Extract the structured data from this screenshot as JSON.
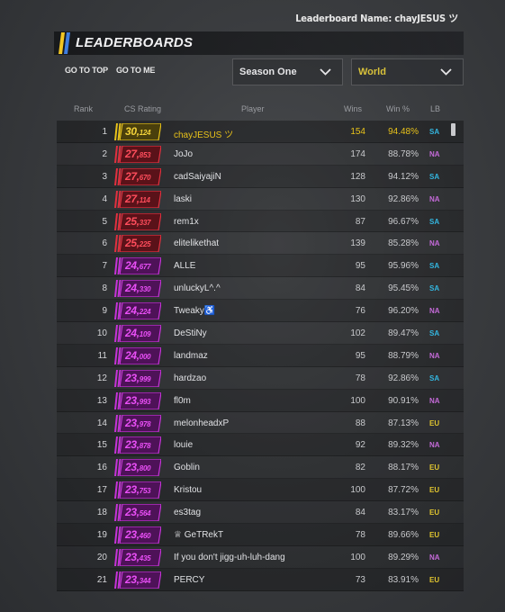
{
  "leaderboard_name": "Leaderboard Name: chayJESUS ツ",
  "title": "LEADERBOARDS",
  "nav": {
    "go_to_top": "GO TO TOP",
    "go_to_me": "GO TO ME"
  },
  "season_select": "Season One",
  "region_select": "World",
  "columns": {
    "rank": "Rank",
    "rating": "CS Rating",
    "player": "Player",
    "wins": "Wins",
    "win_pct": "Win %",
    "lb": "LB"
  },
  "colors": {
    "gold": "#e8c21a",
    "red": "#e2303f",
    "pink": "#c733d9",
    "sa": "#33b6e0",
    "na": "#c46ad8",
    "eu": "#e0c52f"
  },
  "rows": [
    {
      "rank": "1",
      "big": "30",
      "small": "124",
      "tier": "gold",
      "player": "chayJESUS ツ",
      "wins": "154",
      "win_pct": "94.48%",
      "lb": "SA"
    },
    {
      "rank": "2",
      "big": "27",
      "small": "853",
      "tier": "red",
      "player": "JoJo",
      "wins": "174",
      "win_pct": "88.78%",
      "lb": "NA"
    },
    {
      "rank": "3",
      "big": "27",
      "small": "670",
      "tier": "red",
      "player": "cadSaiyajiN",
      "wins": "128",
      "win_pct": "94.12%",
      "lb": "SA"
    },
    {
      "rank": "4",
      "big": "27",
      "small": "114",
      "tier": "red",
      "player": "laski",
      "wins": "130",
      "win_pct": "92.86%",
      "lb": "NA"
    },
    {
      "rank": "5",
      "big": "25",
      "small": "337",
      "tier": "red",
      "player": "rem1x",
      "wins": "87",
      "win_pct": "96.67%",
      "lb": "SA"
    },
    {
      "rank": "6",
      "big": "25",
      "small": "225",
      "tier": "red",
      "player": "elitelikethat",
      "wins": "139",
      "win_pct": "85.28%",
      "lb": "NA"
    },
    {
      "rank": "7",
      "big": "24",
      "small": "677",
      "tier": "pink",
      "player": "ALLE",
      "wins": "95",
      "win_pct": "95.96%",
      "lb": "SA"
    },
    {
      "rank": "8",
      "big": "24",
      "small": "330",
      "tier": "pink",
      "player": "unluckyL^.^",
      "wins": "84",
      "win_pct": "95.45%",
      "lb": "SA"
    },
    {
      "rank": "9",
      "big": "24",
      "small": "224",
      "tier": "pink",
      "player": "Tweaky♿",
      "wins": "76",
      "win_pct": "96.20%",
      "lb": "NA"
    },
    {
      "rank": "10",
      "big": "24",
      "small": "109",
      "tier": "pink",
      "player": "DeStiNy",
      "wins": "102",
      "win_pct": "89.47%",
      "lb": "SA"
    },
    {
      "rank": "11",
      "big": "24",
      "small": "000",
      "tier": "pink",
      "player": "landmaz",
      "wins": "95",
      "win_pct": "88.79%",
      "lb": "NA"
    },
    {
      "rank": "12",
      "big": "23",
      "small": "999",
      "tier": "pink",
      "player": "hardzao",
      "wins": "78",
      "win_pct": "92.86%",
      "lb": "SA"
    },
    {
      "rank": "13",
      "big": "23",
      "small": "993",
      "tier": "pink",
      "player": "fl0m",
      "wins": "100",
      "win_pct": "90.91%",
      "lb": "NA"
    },
    {
      "rank": "14",
      "big": "23",
      "small": "978",
      "tier": "pink",
      "player": "melonheadxP",
      "wins": "88",
      "win_pct": "87.13%",
      "lb": "EU"
    },
    {
      "rank": "15",
      "big": "23",
      "small": "878",
      "tier": "pink",
      "player": "louie",
      "wins": "92",
      "win_pct": "89.32%",
      "lb": "NA"
    },
    {
      "rank": "16",
      "big": "23",
      "small": "800",
      "tier": "pink",
      "player": "Goblin",
      "wins": "82",
      "win_pct": "88.17%",
      "lb": "EU"
    },
    {
      "rank": "17",
      "big": "23",
      "small": "753",
      "tier": "pink",
      "player": "Kristou",
      "wins": "100",
      "win_pct": "87.72%",
      "lb": "EU"
    },
    {
      "rank": "18",
      "big": "23",
      "small": "564",
      "tier": "pink",
      "player": "es3tag",
      "wins": "84",
      "win_pct": "83.17%",
      "lb": "EU"
    },
    {
      "rank": "19",
      "big": "23",
      "small": "460",
      "tier": "pink",
      "player": "♕ GeTRekT",
      "wins": "78",
      "win_pct": "89.66%",
      "lb": "EU"
    },
    {
      "rank": "20",
      "big": "23",
      "small": "435",
      "tier": "pink",
      "player": "If you don't jigg-uh-luh-dang",
      "wins": "100",
      "win_pct": "89.29%",
      "lb": "NA"
    },
    {
      "rank": "21",
      "big": "23",
      "small": "344",
      "tier": "pink",
      "player": "PERCY",
      "wins": "73",
      "win_pct": "83.91%",
      "lb": "EU"
    }
  ]
}
